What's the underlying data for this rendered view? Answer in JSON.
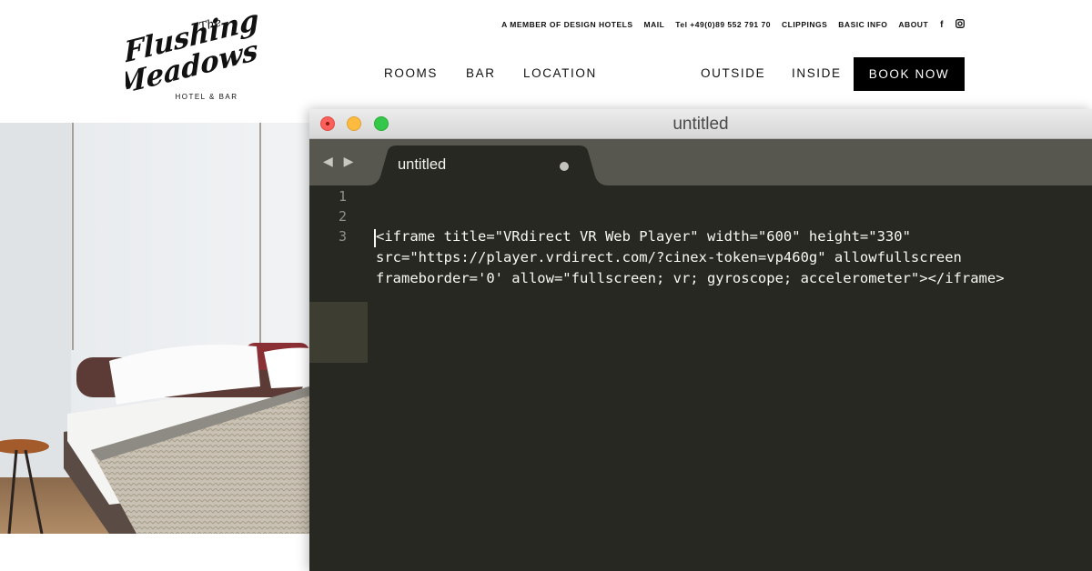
{
  "site": {
    "logo": {
      "line1": "The",
      "line2": "Flushing",
      "line3": "Meadows",
      "subtitle": "HOTEL & BAR"
    },
    "top_nav": [
      {
        "label": "A MEMBER OF DESIGN HOTELS"
      },
      {
        "label": "MAIL"
      },
      {
        "label": "Tel +49(0)89 552 791 70"
      },
      {
        "label": "CLIPPINGS"
      },
      {
        "label": "BASIC INFO"
      },
      {
        "label": "ABOUT"
      }
    ],
    "social": {
      "facebook": "f",
      "instagram": "◙"
    },
    "main_nav": [
      {
        "label": "ROOMS"
      },
      {
        "label": "BAR"
      },
      {
        "label": "LOCATION"
      },
      {
        "label": "OUTSIDE"
      },
      {
        "label": "INSIDE"
      }
    ],
    "book_button": "BOOK NOW",
    "photo_icon": "hotel-room-photo"
  },
  "editor": {
    "window_title": "untitled",
    "nav_arrows": "◀ ▶",
    "tab": {
      "label": "untitled",
      "modified": true
    },
    "line_numbers": [
      "1",
      "2",
      "3"
    ],
    "code_lines": [
      "",
      "",
      "<iframe title=\"VRdirect VR Web Player\" width=\"600\" height=\"330\"",
      "src=\"https://player.vrdirect.com/?cinex-token=vp460g\" allowfullscreen",
      "frameborder='0' allow=\"fullscreen; vr; gyroscope; accelerometer\"></iframe>"
    ],
    "colors": {
      "background": "#272822",
      "gutter_text": "#8f908a",
      "text": "#f8f8f2",
      "tabbar": "#57574f"
    }
  }
}
